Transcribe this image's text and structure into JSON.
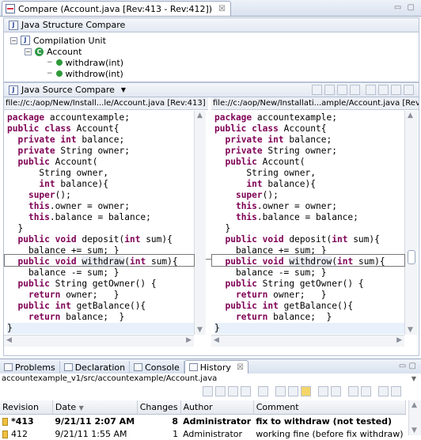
{
  "editor": {
    "tab_title": "Compare (Account.java [Rev:413 - Rev:412])",
    "close_glyph": "☒"
  },
  "structure": {
    "title": "Java Structure Compare",
    "nodes": [
      {
        "label": "Compilation Unit",
        "icon": "java-file-icon"
      },
      {
        "label": "Account",
        "icon": "class-icon"
      },
      {
        "label": "withdraw(int)",
        "icon": "method-icon"
      },
      {
        "label": "withdrow(int)",
        "icon": "method-icon"
      }
    ]
  },
  "source": {
    "title": "Java Source Compare",
    "left_path": "file://c:/aop/New/Install...le/Account.java [Rev:413]",
    "right_path": "file://c:/aop/New/Installati...ample/Account.java [Rev:412]",
    "left_lines": [
      [
        "kw:package",
        " accountexample;"
      ],
      [
        "kw:public",
        " ",
        "kw:class",
        " Account{"
      ],
      [
        "  ",
        "kw:private",
        " ",
        "kw:int",
        " balance;"
      ],
      [
        "  ",
        "kw:private",
        " String owner;"
      ],
      [
        "  ",
        "kw:public",
        " Account("
      ],
      [
        "      String owner,"
      ],
      [
        "      ",
        "kw:int",
        " balance){"
      ],
      [
        "    ",
        "kw:super",
        "();"
      ],
      [
        "    ",
        "kw:this",
        ".owner = owner;"
      ],
      [
        "    ",
        "kw:this",
        ".balance = balance;"
      ],
      [
        "  }"
      ],
      [
        "  ",
        "kw:public",
        " ",
        "kw:void",
        " deposit(",
        "kw:int",
        " sum){"
      ],
      [
        "    balance += sum; }"
      ],
      [
        "  ",
        "kw:public",
        " ",
        "kw:void",
        " ",
        "hl:withdraw",
        "(",
        "kw:int",
        " sum){"
      ],
      [
        "    balance -= sum; }"
      ],
      [
        "  ",
        "kw:public",
        " String getOwner() {"
      ],
      [
        "    ",
        "kw:return",
        " owner;   }"
      ],
      [
        "  ",
        "kw:public",
        " ",
        "kw:int",
        " getBalance(){"
      ],
      [
        "    ",
        "kw:return",
        " balance;  }"
      ],
      [
        "}"
      ]
    ],
    "right_lines": [
      [
        "kw:package",
        " accountexample;"
      ],
      [
        "kw:public",
        " ",
        "kw:class",
        " Account{"
      ],
      [
        "  ",
        "kw:private",
        " ",
        "kw:int",
        " balance;"
      ],
      [
        "  ",
        "kw:private",
        " String owner;"
      ],
      [
        "  ",
        "kw:public",
        " Account("
      ],
      [
        "      String owner,"
      ],
      [
        "      ",
        "kw:int",
        " balance){"
      ],
      [
        "    ",
        "kw:super",
        "();"
      ],
      [
        "    ",
        "kw:this",
        ".owner = owner;"
      ],
      [
        "    ",
        "kw:this",
        ".balance = balance;"
      ],
      [
        "  }"
      ],
      [
        "  ",
        "kw:public",
        " ",
        "kw:void",
        " deposit(",
        "kw:int",
        " sum){"
      ],
      [
        "    balance += sum; }"
      ],
      [
        "  ",
        "kw:public",
        " ",
        "kw:void",
        " ",
        "hl:withdrow",
        "(",
        "kw:int",
        " sum){"
      ],
      [
        "    balance -= sum; }"
      ],
      [
        "  ",
        "kw:public",
        " String getOwner() {"
      ],
      [
        "    ",
        "kw:return",
        " owner;   }"
      ],
      [
        "  ",
        "kw:public",
        " ",
        "kw:int",
        " getBalance(){"
      ],
      [
        "    ",
        "kw:return",
        " balance;  }"
      ],
      [
        "}"
      ]
    ]
  },
  "bottom": {
    "tabs": [
      "Problems",
      "Declaration",
      "Console",
      "History"
    ],
    "active_tab": "History",
    "history_path": "accountexample_v1/src/accountexample/Account.java",
    "columns": [
      "Revision",
      "Date",
      "Changes",
      "Author",
      "Comment"
    ],
    "rows": [
      {
        "revision": "*413",
        "date": "9/21/11 2:07 AM",
        "changes": "8",
        "author": "Administrator",
        "comment": "fix to withdraw (not tested)",
        "bold": true
      },
      {
        "revision": "412",
        "date": "9/21/11 1:55 AM",
        "changes": "1",
        "author": "Administrator",
        "comment": "working fine (before fix withdraw)",
        "bold": false
      }
    ]
  },
  "colors": {
    "keyword": "#7f0055",
    "panel_header": "#e3e8f1",
    "current_line": "#e8f0fb"
  }
}
